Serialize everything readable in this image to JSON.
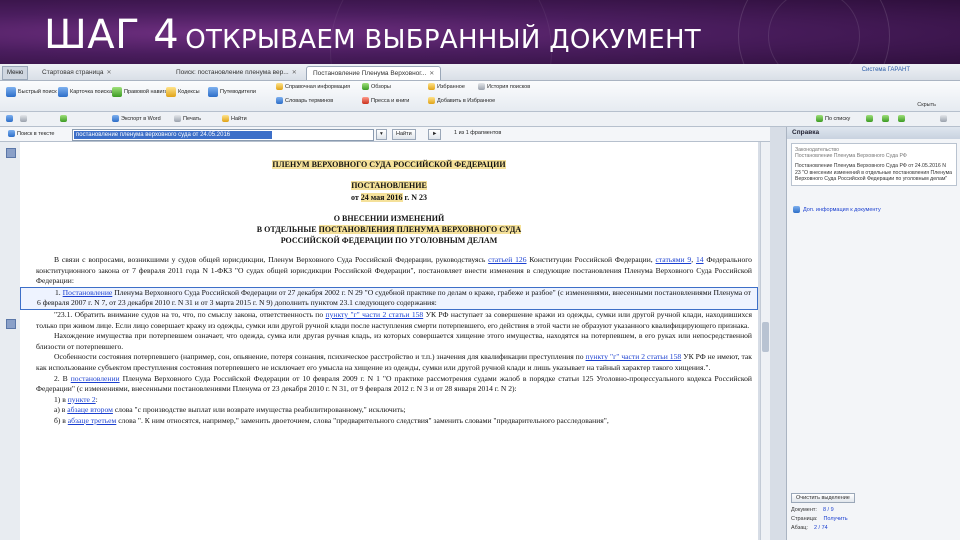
{
  "slide": {
    "title_step": "ШАГ 4",
    "title_rest": "ОТКРЫВАЕМ ВЫБРАННЫЙ ДОКУМЕНТ"
  },
  "app": {
    "menu_label": "Меню",
    "tabs": [
      {
        "label": "Стартовая страница"
      },
      {
        "label": "Поиск: постановление пленума вер..."
      },
      {
        "label": "Постановление Пленума Верховног..."
      }
    ],
    "brand": "Система ГАРАНТ",
    "close_label": "Скрыть",
    "ribbon": {
      "groups": [
        {
          "label": "Быстрый поиск"
        },
        {
          "label": "Карточка поиска"
        },
        {
          "label": "Правовой навигатор"
        },
        {
          "label": "Кодексы"
        },
        {
          "label": "Путеводители"
        },
        {
          "label": "Справочная информация"
        },
        {
          "label": "Обзоры"
        },
        {
          "label": "Словарь терминов"
        },
        {
          "label": "Пресса и книги"
        },
        {
          "label": "Избранное"
        },
        {
          "label": "История поисков"
        },
        {
          "label": "Добавить в Избранное"
        }
      ]
    },
    "toolbar": {
      "export_word": "Экспорт в Word",
      "print": "Печать",
      "find": "Найти",
      "by_list": "По списку"
    },
    "searchbar": {
      "label": "Поиск в тексте",
      "value": "постановление пленума верховного суда от 24.05.2016",
      "find_btn": "Найти",
      "fragments": "1 из 1 фрагментов"
    }
  },
  "document": {
    "court": "ПЛЕНУМ ВЕРХОВНОГО СУДА РОССИЙСКОЙ ФЕДЕРАЦИИ",
    "type": "ПОСТАНОВЛЕНИЕ",
    "date_prefix": "от",
    "date": "24 мая 2016",
    "date_suffix": "г. N 23",
    "subject1": "О ВНЕСЕНИИ ИЗМЕНЕНИЙ",
    "subject2_prefix": "В ОТДЕЛЬНЫЕ",
    "subject2_hl": "ПОСТАНОВЛЕНИЯ ПЛЕНУМА ВЕРХОВНОГО СУДА",
    "subject3": "РОССИЙСКОЙ ФЕДЕРАЦИИ ПО УГОЛОВНЫМ ДЕЛАМ",
    "p1_a": "В связи с вопросами, возникшими у судов общей юрисдикции, Пленум Верховного Суда Российской Федерации, руководствуясь",
    "p1_link1": "статьей 126",
    "p1_b": "Конституции Российской Федерации,",
    "p1_link2": "статьями 9",
    "p1_c": ",",
    "p1_link3": "14",
    "p1_d": "Федерального конституционного закона от 7 февраля 2011 года N 1-ФКЗ \"О судах общей юрисдикции Российской Федерации\", постановляет внести изменения в следующие постановления Пленума Верховного Суда Российской Федерации:",
    "p2_a": "1.",
    "p2_link": "Постановление",
    "p2_b": "Пленума Верховного Суда Российской Федерации от 27 декабря 2002 г. N 29 \"О судебной практике по делам о краже, грабеже и разбое\" (с изменениями, внесенными постановлениями Пленума от 6 февраля 2007 г. N 7, от 23 декабря 2010 г. N 31 и от 3 марта 2015 г. N 9) дополнить пунктом 23.1 следующего содержания:",
    "p3_a": "\"23.1. Обратить внимание судов на то, что, по смыслу закона, ответственность по",
    "p3_link": "пункту \"г\" части 2 статьи 158",
    "p3_b": "УК РФ наступает за совершение кражи из одежды, сумки или другой ручной клади, находившихся только при живом лице. Если лицо совершает кражу из одежды, сумки или другой ручной клади после наступления смерти потерпевшего, его действия в этой части не образуют указанного квалифицирующего признака.",
    "p4": "Нахождение имущества при потерпевшем означает, что одежда, сумка или другая ручная кладь, из которых совершается хищение этого имущества, находятся на потерпевшем, в его руках или непосредственной близости от потерпевшего.",
    "p5_a": "Особенности состояния потерпевшего (например, сон, опьянение, потеря сознания, психическое расстройство и т.п.) значения для квалификации преступления по",
    "p5_link": "пункту \"г\" части 2 статьи 158",
    "p5_b": "УК РФ не имеют, так как использование субъектом преступления состояния потерпевшего не исключает его умысла на хищение из одежды, сумки или другой ручной клади и лишь указывает на тайный характер такого хищения.\".",
    "p6_a": "2. В",
    "p6_link": "постановлении",
    "p6_b": "Пленума Верховного Суда Российской Федерации от 10 февраля 2009 г. N 1 \"О практике рассмотрения судами жалоб в порядке статьи 125 Уголовно-процессуального кодекса Российской Федерации\" (с изменениями, внесенными постановлениями Пленума от 23 декабря 2010 г. N 31, от 9 февраля 2012 г. N 3 и от 28 января 2014 г. N 2):",
    "p7_a": "1) в",
    "p7_link": "пункте 2",
    "p7_b": ":",
    "p8_a": "а) в",
    "p8_link": "абзаце втором",
    "p8_b": "слова \"с производстве выплат или возврате имущества реабилитированному,\" исключить;",
    "p9_a": "б) в",
    "p9_link": "абзаце третьем",
    "p9_b": "слова \". К ним относятся, например,\" заменить двоеточием, слова \"предварительного следствия\" заменить словами \"предварительного расследования\","
  },
  "right_panel": {
    "header": "Справка",
    "box1_gray1": "Законодательство",
    "box1_gray2": "Постановление Пленума Верховного Суда РФ",
    "box2": "Постановление Пленума Верховного Суда РФ от 24.05.2016 N 23 \"О внесении изменений в отдельные постановления Пленума Верховного Суда Российской Федерации по уголовным делам\"",
    "link": "Доп. информация к документу",
    "btn_clear": "Очистить выделение",
    "doc_label": "Документ:",
    "doc_val": "8 / 9",
    "page_label": "Страница:",
    "page_val": "Получить",
    "para_label": "Абзац:",
    "para_val": "2 / 74"
  },
  "colors": {
    "header_bg": "#4a1d5e",
    "selection": "#3d6fc8",
    "highlight": "#f5e19a",
    "link": "#1a3fd0"
  }
}
